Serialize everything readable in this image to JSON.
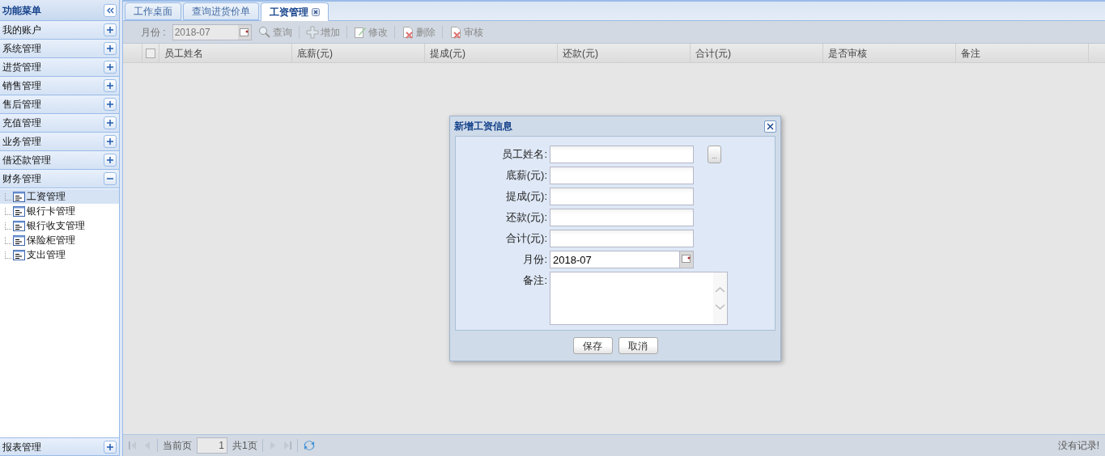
{
  "sidebar": {
    "title": "功能菜单",
    "groups": [
      {
        "label": "我的账户",
        "expanded": false
      },
      {
        "label": "系统管理",
        "expanded": false
      },
      {
        "label": "进货管理",
        "expanded": false
      },
      {
        "label": "销售管理",
        "expanded": false
      },
      {
        "label": "售后管理",
        "expanded": false
      },
      {
        "label": "充值管理",
        "expanded": false
      },
      {
        "label": "业务管理",
        "expanded": false
      },
      {
        "label": "借还款管理",
        "expanded": false
      },
      {
        "label": "财务管理",
        "expanded": true,
        "children": [
          {
            "label": "工资管理",
            "selected": true
          },
          {
            "label": "银行卡管理",
            "selected": false
          },
          {
            "label": "银行收支管理",
            "selected": false
          },
          {
            "label": "保险柜管理",
            "selected": false
          },
          {
            "label": "支出管理",
            "selected": false
          }
        ]
      }
    ],
    "footer_group": {
      "label": "报表管理",
      "expanded": false
    }
  },
  "tabs": [
    {
      "label": "工作桌面",
      "selected": false,
      "closable": false
    },
    {
      "label": "查询进货价单",
      "selected": false,
      "closable": false
    },
    {
      "label": "工资管理",
      "selected": true,
      "closable": true
    }
  ],
  "toolbar": {
    "month_label": "月份 :",
    "month_value": "2018-07",
    "buttons": [
      {
        "label": "查询"
      },
      {
        "label": "增加"
      },
      {
        "label": "修改"
      },
      {
        "label": "删除"
      },
      {
        "label": "审核"
      }
    ]
  },
  "table": {
    "select_all_checked": false,
    "columns": [
      "员工姓名",
      "底薪(元)",
      "提成(元)",
      "还款(元)",
      "合计(元)",
      "是否审核",
      "备注"
    ]
  },
  "pager": {
    "current_label": "当前页",
    "page": "1",
    "total": "共1页",
    "status": "没有记录!"
  },
  "dialog": {
    "title": "新增工资信息",
    "fields": [
      {
        "label": "员工姓名:",
        "kind": "picker"
      },
      {
        "label": "底薪(元):",
        "kind": "text"
      },
      {
        "label": "提成(元):",
        "kind": "text"
      },
      {
        "label": "还款(元):",
        "kind": "text"
      },
      {
        "label": "合计(元):",
        "kind": "text"
      },
      {
        "label": "月份:",
        "kind": "date",
        "value": "2018-07"
      },
      {
        "label": "备注:",
        "kind": "textarea"
      }
    ],
    "picker_button": "...",
    "buttons": [
      "保存",
      "取消"
    ]
  }
}
